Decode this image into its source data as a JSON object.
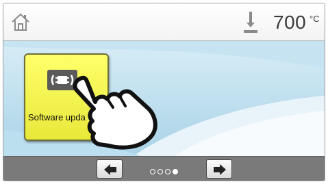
{
  "header": {
    "home_icon": "home-icon",
    "temperature_icon": "thermometer-icon",
    "temperature_value": "700",
    "temperature_unit": "°C"
  },
  "main": {
    "tile": {
      "label": "Software upda",
      "icon": "software-update-icon",
      "color": "#ffff55"
    },
    "pointer_icon": "pointing-hand-icon"
  },
  "footer": {
    "prev_icon": "arrow-left-icon",
    "next_icon": "arrow-right-icon",
    "page_count": 4,
    "active_page": 4
  }
}
